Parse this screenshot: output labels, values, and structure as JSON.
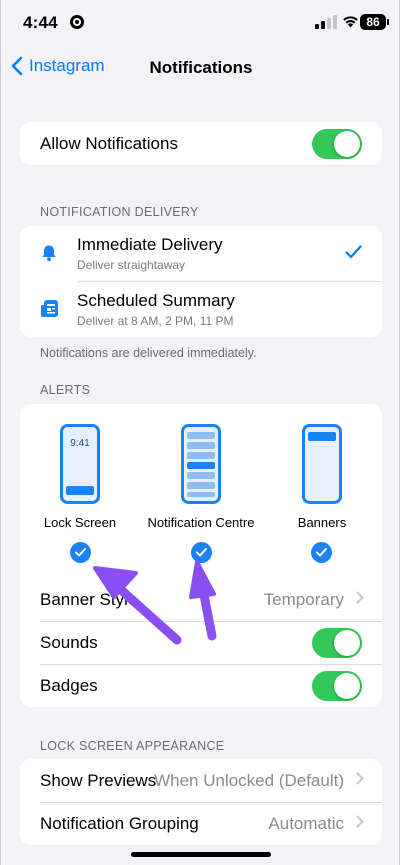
{
  "status_bar": {
    "time": "4:44",
    "battery": "86"
  },
  "nav": {
    "back_label": "Instagram",
    "title": "Notifications"
  },
  "allow_notifications": {
    "label": "Allow Notifications",
    "enabled": true
  },
  "delivery": {
    "header": "NOTIFICATION DELIVERY",
    "options": [
      {
        "title": "Immediate Delivery",
        "subtitle": "Deliver straightaway",
        "icon": "bell-icon",
        "selected": true
      },
      {
        "title": "Scheduled Summary",
        "subtitle": "Deliver at 8 AM, 2 PM, 11 PM",
        "icon": "summary-icon",
        "selected": false
      }
    ],
    "footer": "Notifications are delivered immediately."
  },
  "alerts": {
    "header": "ALERTS",
    "items": [
      {
        "label": "Lock Screen",
        "screen_time": "9:41",
        "checked": true
      },
      {
        "label": "Notification Centre",
        "checked": true
      },
      {
        "label": "Banners",
        "checked": true
      }
    ],
    "banner_style": {
      "label": "Banner Style",
      "value": "Temporary"
    },
    "sounds": {
      "label": "Sounds",
      "enabled": true
    },
    "badges": {
      "label": "Badges",
      "enabled": true
    }
  },
  "lock_screen_appearance": {
    "header": "LOCK SCREEN APPEARANCE",
    "show_previews": {
      "label": "Show Previews",
      "value": "When Unlocked (Default)"
    },
    "grouping": {
      "label": "Notification Grouping",
      "value": "Automatic"
    }
  },
  "colors": {
    "accent": "#007aff",
    "toggle_on": "#34c759",
    "annotation_arrow": "#8a4ff0"
  }
}
